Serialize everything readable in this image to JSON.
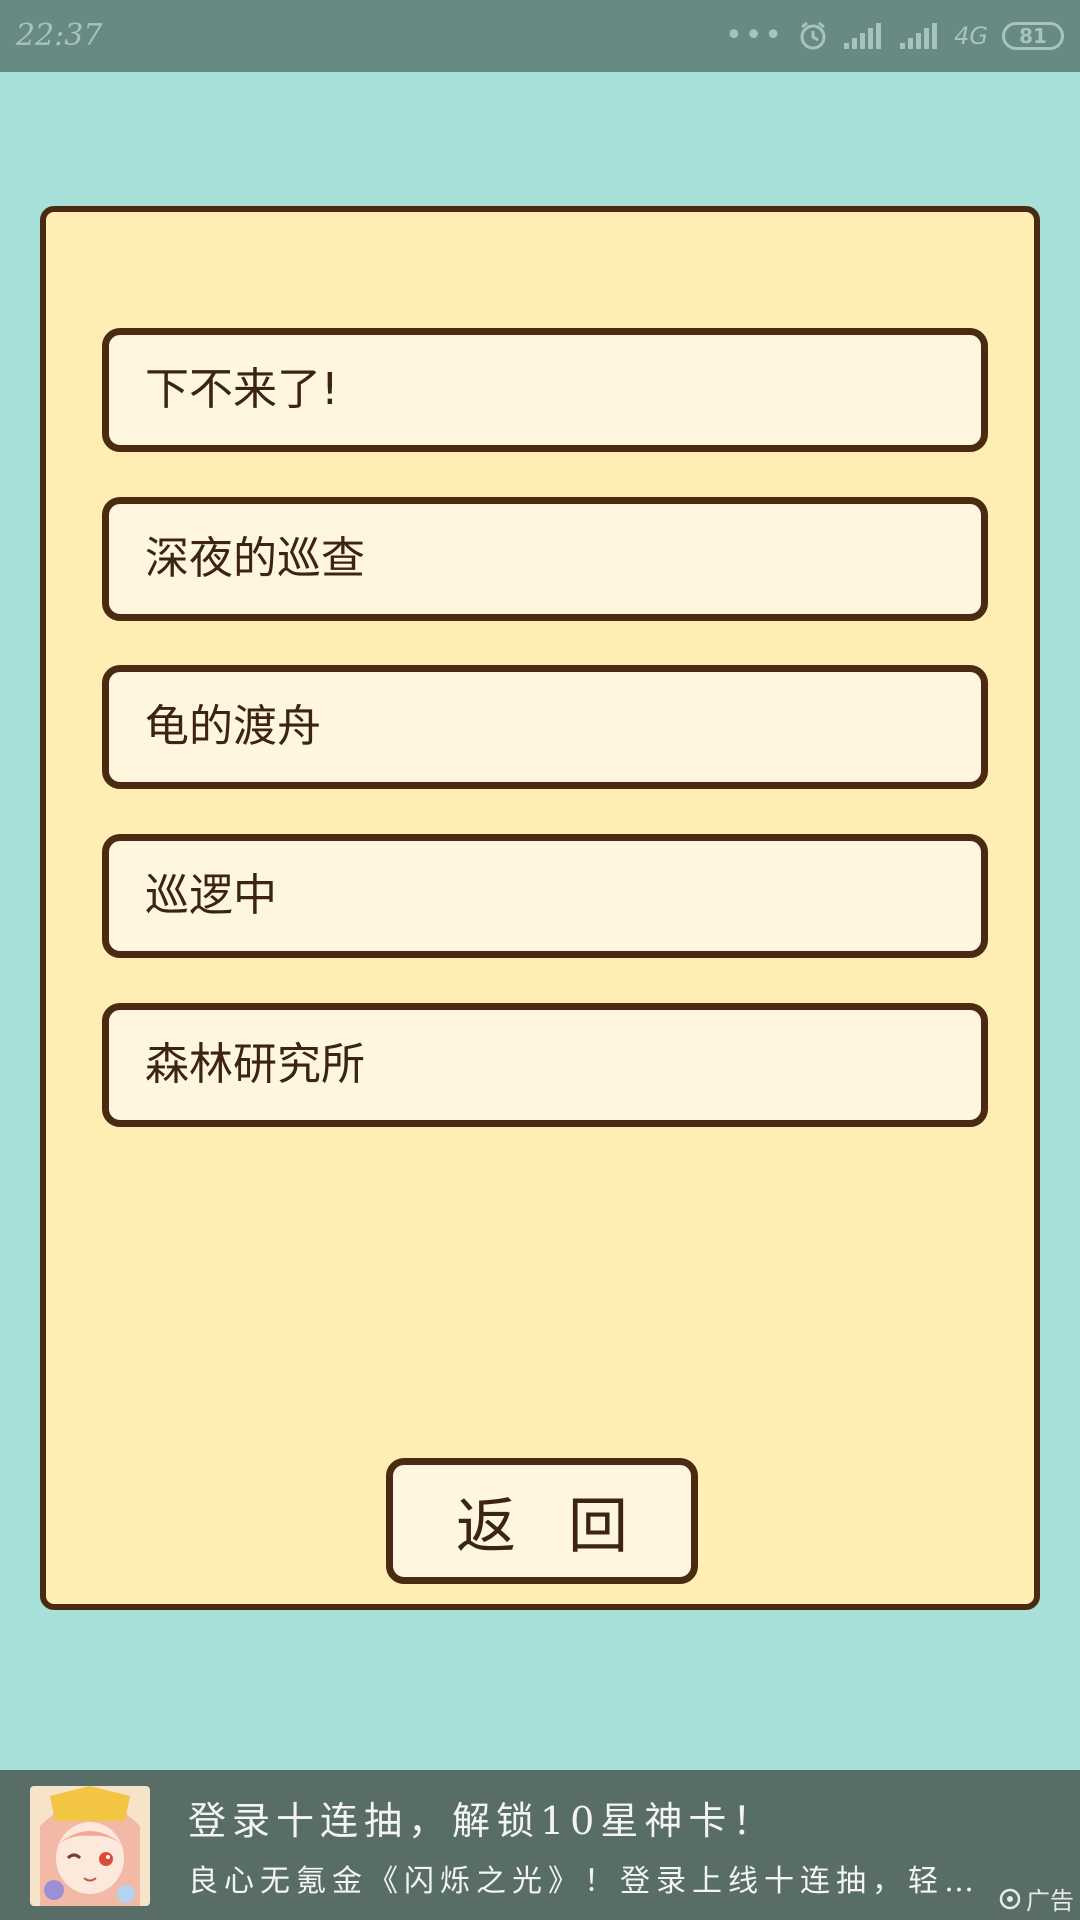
{
  "status_bar": {
    "time": "22:37",
    "network": "4G",
    "battery": "81",
    "icons": [
      "more-dots-icon",
      "alarm-icon",
      "signal-icon",
      "signal-icon"
    ]
  },
  "menu": {
    "items": [
      {
        "label": "下不来了!"
      },
      {
        "label": "深夜的巡查"
      },
      {
        "label": "龟的渡舟"
      },
      {
        "label": "巡逻中"
      },
      {
        "label": "森林研究所"
      }
    ],
    "return_label": "返回"
  },
  "ad": {
    "title": "登录十连抽，解锁10星神卡！",
    "description": "良心无氪金《闪烁之光》！登录上线十连抽，轻…",
    "tag": "广告",
    "thumb_icon": "anime-girl-avatar"
  },
  "colors": {
    "background": "#a7e0d8",
    "panel": "#ffeeb3",
    "button_fill": "#fff6df",
    "border": "#4a2a10",
    "status_bar": "#678a84",
    "ad_bar": "#586d67"
  }
}
